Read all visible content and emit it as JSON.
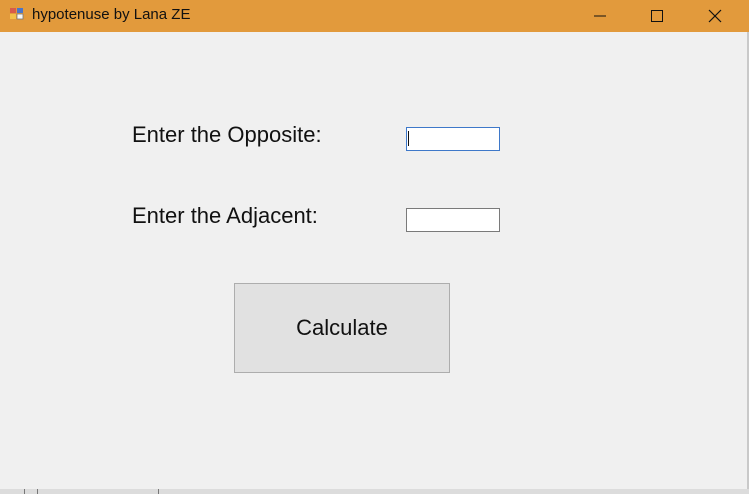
{
  "window": {
    "title": "hypotenuse by Lana ZE",
    "title_bar_color": "#e29a3c",
    "background_color": "#f0f0f0",
    "controls": {
      "minimize_icon": "minimize-icon",
      "maximize_icon": "maximize-icon",
      "close_icon": "close-icon"
    }
  },
  "form": {
    "opposite": {
      "label": "Enter the Opposite:",
      "value": "",
      "placeholder": ""
    },
    "adjacent": {
      "label": "Enter the Adjacent:",
      "value": "",
      "placeholder": ""
    },
    "calculate_label": "Calculate"
  }
}
